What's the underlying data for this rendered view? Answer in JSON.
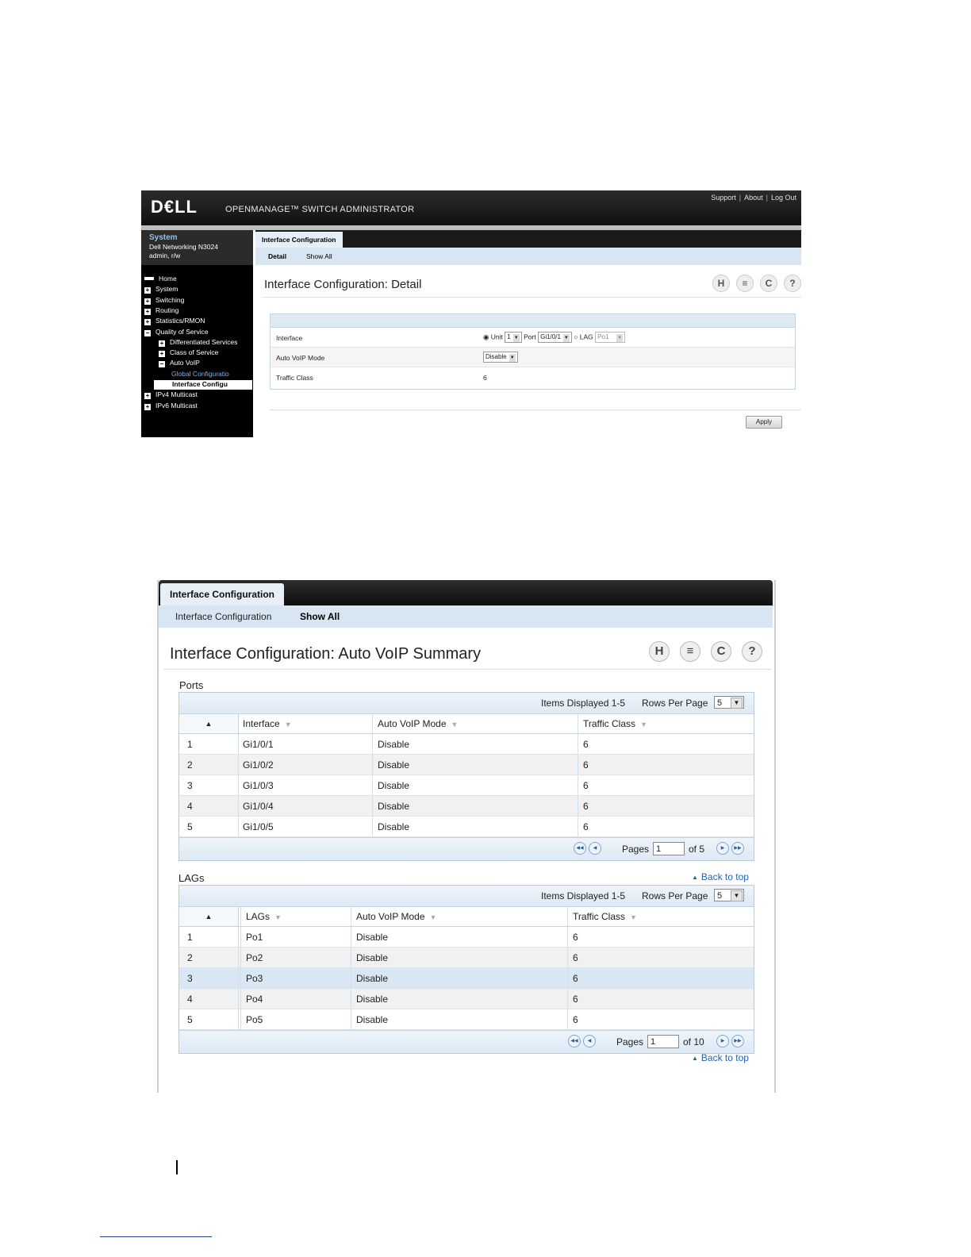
{
  "detail_screen": {
    "logo": "D€LL",
    "app_name": "OPENMANAGE™ SWITCH ADMINISTRATOR",
    "top_links": [
      "Support",
      "About",
      "Log Out"
    ],
    "system_box": {
      "title": "System",
      "model": "Dell Networking N3024",
      "user": "admin, r/w"
    },
    "nav": [
      {
        "label": "Home",
        "marker": "▬"
      },
      {
        "label": "System",
        "marker": "+"
      },
      {
        "label": "Switching",
        "marker": "+"
      },
      {
        "label": "Routing",
        "marker": "+"
      },
      {
        "label": "Statistics/RMON",
        "marker": "+"
      },
      {
        "label": "Quality of Service",
        "marker": "−"
      },
      {
        "label": "Differentiated Services",
        "marker": "+"
      },
      {
        "label": "Class of Service",
        "marker": "+"
      },
      {
        "label": "Auto VoIP",
        "marker": "−"
      },
      {
        "label": "Global Configuratio",
        "marker": ""
      },
      {
        "label": "Interface Configu",
        "marker": ""
      },
      {
        "label": "IPv4 Multicast",
        "marker": "+"
      },
      {
        "label": "IPv6 Multicast",
        "marker": "+"
      }
    ],
    "tab": "Interface Configuration",
    "subtabs": [
      "Detail",
      "Show All"
    ],
    "title": "Interface Configuration: Detail",
    "icons": [
      "save-icon",
      "print-icon",
      "refresh-icon",
      "help-icon"
    ],
    "icon_glyphs": [
      "H",
      "≡",
      "C",
      "?"
    ],
    "form": {
      "interface_label": "Interface",
      "unit_label": "Unit",
      "unit_value": "1",
      "port_label": "Port",
      "port_value": "Gi1/0/1",
      "lag_label": "LAG",
      "lag_value": "Po1",
      "mode_label": "Auto VoIP Mode",
      "mode_value": "Disable",
      "traffic_label": "Traffic Class",
      "traffic_value": "6"
    },
    "apply_label": "Apply"
  },
  "summary_screen": {
    "tab": "Interface Configuration",
    "subtabs": [
      "Interface Configuration",
      "Show All"
    ],
    "title": "Interface Configuration: Auto VoIP Summary",
    "icons": [
      "save-icon",
      "print-icon",
      "refresh-icon",
      "help-icon"
    ],
    "icon_glyphs": [
      "H",
      "≡",
      "C",
      "?"
    ],
    "ports": {
      "label": "Ports",
      "items_displayed": "Items Displayed 1-5",
      "rows_per_page_label": "Rows Per Page",
      "rows_per_page": "5",
      "columns": [
        "Interface",
        "Auto VoIP Mode",
        "Traffic Class"
      ],
      "rows": [
        [
          "1",
          "Gi1/0/1",
          "Disable",
          "6"
        ],
        [
          "2",
          "Gi1/0/2",
          "Disable",
          "6"
        ],
        [
          "3",
          "Gi1/0/3",
          "Disable",
          "6"
        ],
        [
          "4",
          "Gi1/0/4",
          "Disable",
          "6"
        ],
        [
          "5",
          "Gi1/0/5",
          "Disable",
          "6"
        ]
      ],
      "pages_label": "Pages",
      "page": "1",
      "of_pages": "of 5"
    },
    "lags": {
      "label": "LAGs",
      "back_to_top": "Back to top",
      "items_displayed": "Items Displayed 1-5",
      "rows_per_page_label": "Rows Per Page",
      "rows_per_page": "5",
      "columns": [
        "LAGs",
        "Auto VoIP Mode",
        "Traffic Class"
      ],
      "rows": [
        [
          "1",
          "Po1",
          "Disable",
          "6"
        ],
        [
          "2",
          "Po2",
          "Disable",
          "6"
        ],
        [
          "3",
          "Po3",
          "Disable",
          "6"
        ],
        [
          "4",
          "Po4",
          "Disable",
          "6"
        ],
        [
          "5",
          "Po5",
          "Disable",
          "6"
        ]
      ],
      "selected_row": 3,
      "pages_label": "Pages",
      "page": "1",
      "of_pages": "of 10"
    },
    "back_to_top_bottom": "Back to top"
  }
}
